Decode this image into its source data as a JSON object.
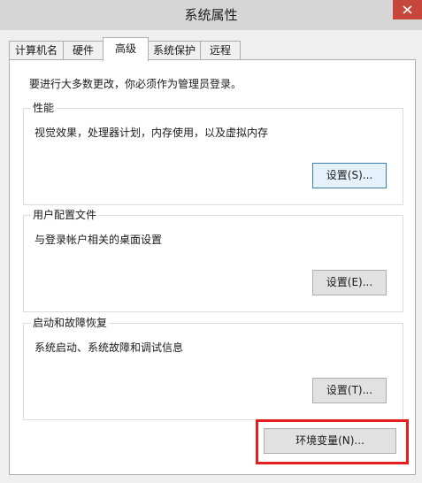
{
  "window": {
    "title": "系统属性"
  },
  "tabs": [
    {
      "label": "计算机名",
      "active": false
    },
    {
      "label": "硬件",
      "active": false
    },
    {
      "label": "高级",
      "active": true
    },
    {
      "label": "系统保护",
      "active": false
    },
    {
      "label": "远程",
      "active": false
    }
  ],
  "advanced": {
    "admin_note": "要进行大多数更改，你必须作为管理员登录。",
    "performance": {
      "title": "性能",
      "description": "视觉效果，处理器计划，内存使用，以及虚拟内存",
      "button_label": "设置(S)..."
    },
    "user_profiles": {
      "title": "用户配置文件",
      "description": "与登录帐户相关的桌面设置",
      "button_label": "设置(E)..."
    },
    "startup_recovery": {
      "title": "启动和故障恢复",
      "description": "系统启动、系统故障和调试信息",
      "button_label": "设置(T)..."
    },
    "env_button_label": "环境变量(N)..."
  },
  "colors": {
    "highlight": "#e51e1e",
    "close_button": "#c7463b",
    "focus_border": "#3c7fb1"
  }
}
